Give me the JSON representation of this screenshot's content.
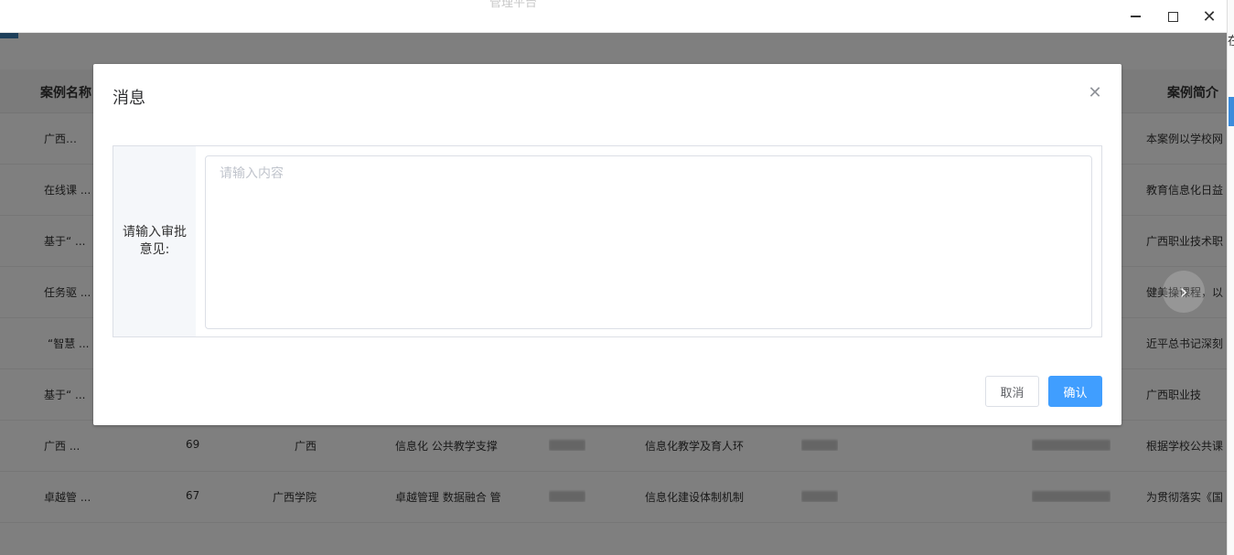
{
  "window": {
    "title": "管理平台"
  },
  "table": {
    "headers": {
      "case_name": "案例名称",
      "case_intro": "案例简介"
    },
    "rows": [
      {
        "name": "广西…",
        "intro": "本案例以学校网"
      },
      {
        "name": "在线课 ...",
        "intro": "教育信息化日益"
      },
      {
        "name": "基于“ ...",
        "intro": "广西职业技术职"
      },
      {
        "name": "任务驱 ...",
        "intro": "健美操课程，以"
      },
      {
        "name": "“智慧 ...",
        "intro": "近平总书记深刻"
      },
      {
        "name": "基于“ ...",
        "intro": "广西职业技"
      },
      {
        "name": "广西 ...",
        "score": "69",
        "school": "广西",
        "keywords": "信息化 公共教学支撑",
        "category": "信息化教学及育人环",
        "intro": "根据学校公共课"
      },
      {
        "name": "卓越管 ...",
        "score": "67",
        "school": "广西学院",
        "keywords": "卓越管理 数据融合 管",
        "category": "信息化建设体制机制",
        "intro": "为贯彻落实《国"
      }
    ]
  },
  "dialog": {
    "title": "消息",
    "form_label": "请输入审批意见:",
    "textarea_placeholder": "请输入内容",
    "textarea_value": "",
    "cancel_label": "取消",
    "confirm_label": "确认"
  },
  "icons": {
    "close": "close-icon",
    "next": "chevron-right-icon",
    "minimize": "minimize-icon",
    "maximize": "maximize-icon",
    "window_close": "window-close-icon"
  },
  "colors": {
    "primary": "#409eff",
    "overlay": "rgba(0,0,0,0.5)"
  }
}
